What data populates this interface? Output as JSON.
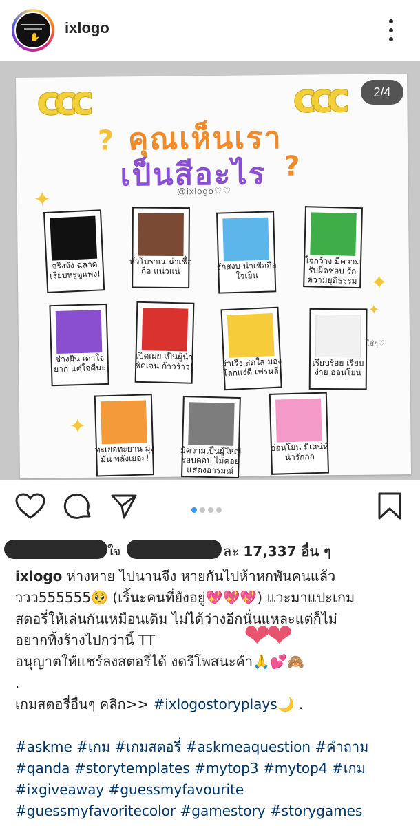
{
  "header": {
    "username": "ixlogo",
    "menu_icon": "more-vertical-icon"
  },
  "post_image": {
    "page_indicator": "2/4",
    "deco_left": "ccc",
    "deco_right": "ccc",
    "title_line1": [
      "ค",
      "ุ",
      "ณ",
      "เ",
      "ห็นเรา"
    ],
    "title_line1_full": "คุณเห็นเรา",
    "title_line2_full": "เป็นสีอะไร",
    "handle": "@ixlogo♡♡",
    "side_note": "ใส่ๆ♡",
    "cards": [
      {
        "color": "#111111",
        "caption": "จริงจัง ฉลาด เรียบหรูดูแพง!"
      },
      {
        "color": "#7a4a35",
        "caption": "หัวโบราณ น่าเชื่อถือ แน่วแน่"
      },
      {
        "color": "#5cb6ea",
        "caption": "รักสงบ น่าเชื่อถือ ใจเย็น"
      },
      {
        "color": "#3fae49",
        "caption": "ใจกว้าง มีความรับผิดชอบ รักความยุติธรรม"
      },
      {
        "color": "#8a4fd1",
        "caption": "ช่างฝัน เดาใจยาก แต่ใจดีนะ"
      },
      {
        "color": "#d9322f",
        "caption": "เปิดเผย เป็นผู้นำ ชัดเจน ก้าวร้าว!"
      },
      {
        "color": "#f6cc3a",
        "caption": "ร่าเริง สดใส มองโลกแง่ดี เฟรนลี่!"
      },
      {
        "color": "#f1f1f1",
        "caption": "เรียบร้อย เรียบง่าย อ่อนโยน"
      },
      {
        "color": "#f59a3a",
        "caption": "ทะเยอทะยาน มุ่งมั่น พลังเยอะ!"
      },
      {
        "color": "#7d7d7d",
        "caption": "มีความเป็นผู้ใหญ่ รอบคอบ ไม่ค่อยแสดงอารมณ์"
      },
      {
        "color": "#f49ac8",
        "caption": "อ่อนโยน มีเสน่ห์ น่ารักกก"
      }
    ]
  },
  "actions": {
    "like_icon": "heart-icon",
    "comment_icon": "comment-icon",
    "share_icon": "send-icon",
    "save_icon": "bookmark-icon",
    "carousel_active": 1,
    "carousel_total": 4
  },
  "likes": {
    "fragment": "ใจ",
    "suffix": "ละ ",
    "count": "17,337",
    "others": " อื่น ๆ"
  },
  "caption": {
    "username": "ixlogo",
    "line1": " ห่างหาย ไปนานจึง หายกันไปห้าหกพันคนแล้ว",
    "line2a": "ววว555555",
    "line2_emoji1": "🥺",
    "line2b": " (เริ้นะคนที่ยังอยู่",
    "line2_hearts": "💖💖💖",
    "line2c": ") แวะมาแปะเกม",
    "line3": "สตอรี่ให้เล่นกันเหมือนเดิม ไม่ได้ว่างอีกนั่นแหละแต่ก็ไม่",
    "line4": "อยากทิ้งร้างไปกว่านี้ TT",
    "line5a": "อนุญาตให้แชร์ลงสตอรี่ได้ งดรีโพสนะค้า",
    "line5_emoji": "🙏💕🙈",
    "line6": ".",
    "line7a": "เกมสตอรี่อื่นๆ คลิก>> ",
    "line7_tag": "#ixlogostoryplays",
    "line7_emoji": "🌙",
    "line7b": " .",
    "hashtags_line1": "#askme #เกม #เกมสตอรี่ #askmeaquestion #คำถาม",
    "hashtags_line2": "#qanda #storytemplates #mytop3 #mytop4 #เกม",
    "hashtags_line3": "#ixgiveaway #guessmyfavourite",
    "hashtags_line4": "#guessmyfavoritecolor #gamestory #storygames"
  },
  "overlay_hearts": "❤❤"
}
